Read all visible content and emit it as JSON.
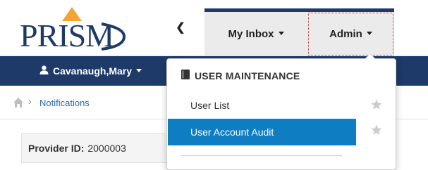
{
  "header": {
    "logo_text": "PRISM",
    "nav": {
      "inbox_label": "My Inbox",
      "admin_label": "Admin"
    }
  },
  "userbar": {
    "user_name": "Cavanaugh,Mary"
  },
  "breadcrumb": {
    "current": "Notifications"
  },
  "provider": {
    "label": "Provider ID:",
    "value": "2000003"
  },
  "admin_menu": {
    "section_title": "USER MAINTENANCE",
    "items": [
      {
        "label": "User List",
        "selected": false
      },
      {
        "label": "User Account Audit",
        "selected": true
      }
    ]
  },
  "colors": {
    "brand_navy": "#1d3a68",
    "highlight_blue": "#0f7dc2",
    "logo_gold": "#f2a533"
  },
  "icons": [
    "chevron-left-icon",
    "caret-down-icon",
    "user-icon",
    "home-icon",
    "book-icon",
    "star-icon"
  ]
}
